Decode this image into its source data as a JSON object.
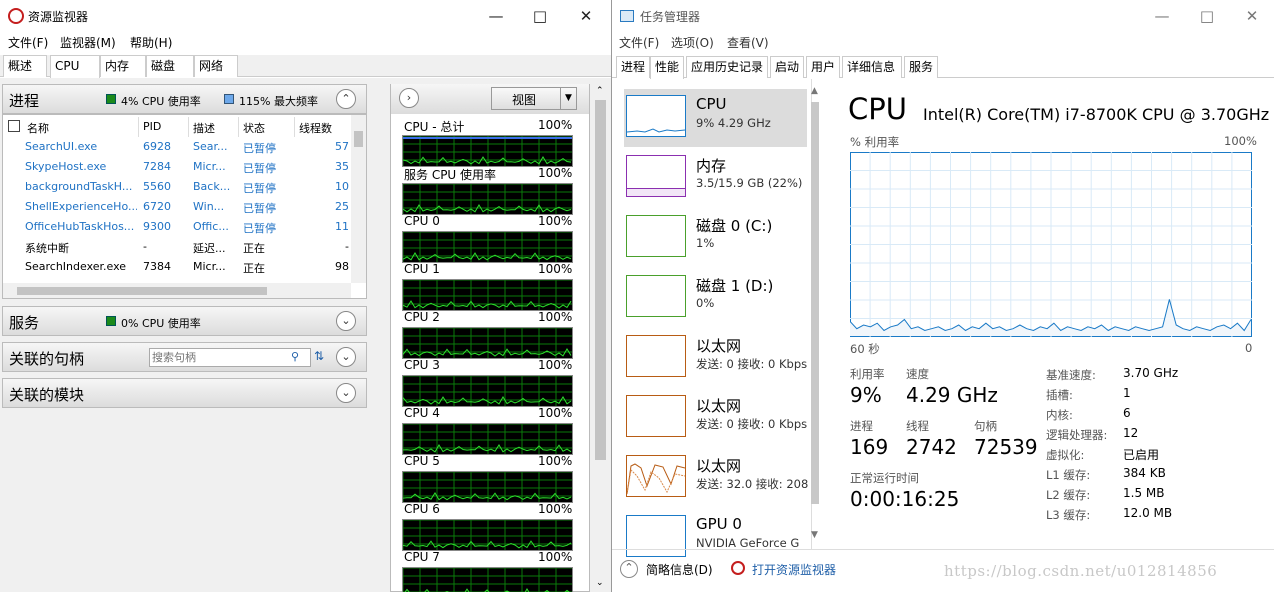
{
  "rm": {
    "title": "资源监视器",
    "menu": [
      "文件(F)",
      "监视器(M)",
      "帮助(H)"
    ],
    "tabs": [
      "概述",
      "CPU",
      "内存",
      "磁盘",
      "网络"
    ],
    "processes": {
      "title": "进程",
      "cpu_usage": "4% CPU 使用率",
      "max_freq": "115% 最大频率",
      "columns": [
        "名称",
        "PID",
        "描述",
        "状态",
        "线程数"
      ],
      "rows": [
        {
          "name": "SearchUI.exe",
          "pid": "6928",
          "desc": "Sear...",
          "status": "已暂停",
          "threads": "57",
          "suspended": true
        },
        {
          "name": "SkypeHost.exe",
          "pid": "7284",
          "desc": "Micr...",
          "status": "已暂停",
          "threads": "35",
          "suspended": true
        },
        {
          "name": "backgroundTaskH...",
          "pid": "5560",
          "desc": "Back...",
          "status": "已暂停",
          "threads": "10",
          "suspended": true
        },
        {
          "name": "ShellExperienceHo...",
          "pid": "6720",
          "desc": "Win...",
          "status": "已暂停",
          "threads": "25",
          "suspended": true
        },
        {
          "name": "OfficeHubTaskHos...",
          "pid": "9300",
          "desc": "Offic...",
          "status": "已暂停",
          "threads": "11",
          "suspended": true
        },
        {
          "name": "系统中断",
          "pid": "-",
          "desc": "延迟...",
          "status": "正在",
          "threads": "-",
          "suspended": false
        },
        {
          "name": "SearchIndexer.exe",
          "pid": "7384",
          "desc": "Micr...",
          "status": "正在",
          "threads": "98",
          "suspended": false
        }
      ]
    },
    "services": {
      "title": "服务",
      "cpu_usage": "0% CPU 使用率"
    },
    "handles": {
      "title": "关联的句柄",
      "search_placeholder": "搜索句柄"
    },
    "modules": {
      "title": "关联的模块"
    },
    "view_label": "视图",
    "graphs": [
      {
        "label": "CPU - 总计",
        "pct": "100%"
      },
      {
        "label": "服务 CPU 使用率",
        "pct": "100%"
      },
      {
        "label": "CPU 0",
        "pct": "100%"
      },
      {
        "label": "CPU 1",
        "pct": "100%"
      },
      {
        "label": "CPU 2",
        "pct": "100%"
      },
      {
        "label": "CPU 3",
        "pct": "100%"
      },
      {
        "label": "CPU 4",
        "pct": "100%"
      },
      {
        "label": "CPU 5",
        "pct": "100%"
      },
      {
        "label": "CPU 6",
        "pct": "100%"
      },
      {
        "label": "CPU 7",
        "pct": "100%"
      }
    ]
  },
  "tm": {
    "title": "任务管理器",
    "menu": [
      "文件(F)",
      "选项(O)",
      "查看(V)"
    ],
    "tabs": [
      "进程",
      "性能",
      "应用历史记录",
      "启动",
      "用户",
      "详细信息",
      "服务"
    ],
    "sidebar": [
      {
        "name": "CPU",
        "sub": "9% 4.29 GHz",
        "color": "#1a7ac7"
      },
      {
        "name": "内存",
        "sub": "3.5/15.9 GB (22%)",
        "color": "#8b2fb0"
      },
      {
        "name": "磁盘 0 (C:)",
        "sub": "1%",
        "color": "#4aa02c"
      },
      {
        "name": "磁盘 1 (D:)",
        "sub": "0%",
        "color": "#4aa02c"
      },
      {
        "name": "以太网",
        "sub": "发送: 0 接收: 0 Kbps",
        "color": "#b85c14"
      },
      {
        "name": "以太网",
        "sub": "发送: 0 接收: 0 Kbps",
        "color": "#b85c14"
      },
      {
        "name": "以太网",
        "sub": "发送: 32.0 接收: 208",
        "color": "#b85c14"
      },
      {
        "name": "GPU 0",
        "sub": "NVIDIA GeForce G",
        "color": "#1a7ac7"
      }
    ],
    "main": {
      "title": "CPU",
      "model": "Intel(R) Core(TM) i7-8700K CPU @ 3.70GHz",
      "util_label": "% 利用率",
      "util_max": "100%",
      "x_left": "60 秒",
      "x_right": "0",
      "chart_series": [
        8,
        4,
        6,
        5,
        7,
        3,
        5,
        6,
        9,
        4,
        5,
        3,
        4,
        5,
        3,
        4,
        6,
        3,
        5,
        4,
        7,
        4,
        5,
        3,
        4,
        6,
        4,
        3,
        5,
        4,
        7,
        3,
        5,
        4,
        3,
        5,
        4,
        6,
        3,
        5,
        4,
        3,
        5,
        4,
        3,
        4,
        5,
        20,
        6,
        4,
        3,
        5,
        4,
        3,
        5,
        6,
        4,
        7,
        3,
        9
      ],
      "stats": {
        "utilization_label": "利用率",
        "utilization": "9%",
        "speed_label": "速度",
        "speed": "4.29 GHz",
        "processes_label": "进程",
        "processes": "169",
        "threads_label": "线程",
        "threads": "2742",
        "handles_label": "句柄",
        "handles": "72539",
        "uptime_label": "正常运行时间",
        "uptime": "0:00:16:25"
      },
      "specs": [
        {
          "k": "基准速度:",
          "v": "3.70 GHz"
        },
        {
          "k": "插槽:",
          "v": "1"
        },
        {
          "k": "内核:",
          "v": "6"
        },
        {
          "k": "逻辑处理器:",
          "v": "12"
        },
        {
          "k": "虚拟化:",
          "v": "已启用"
        },
        {
          "k": "L1 缓存:",
          "v": "384 KB"
        },
        {
          "k": "L2 缓存:",
          "v": "1.5 MB"
        },
        {
          "k": "L3 缓存:",
          "v": "12.0 MB"
        }
      ]
    },
    "footer": {
      "summary": "简略信息(D)",
      "open_rm": "打开资源监视器"
    }
  },
  "watermark": "https://blog.csdn.net/u012814856"
}
